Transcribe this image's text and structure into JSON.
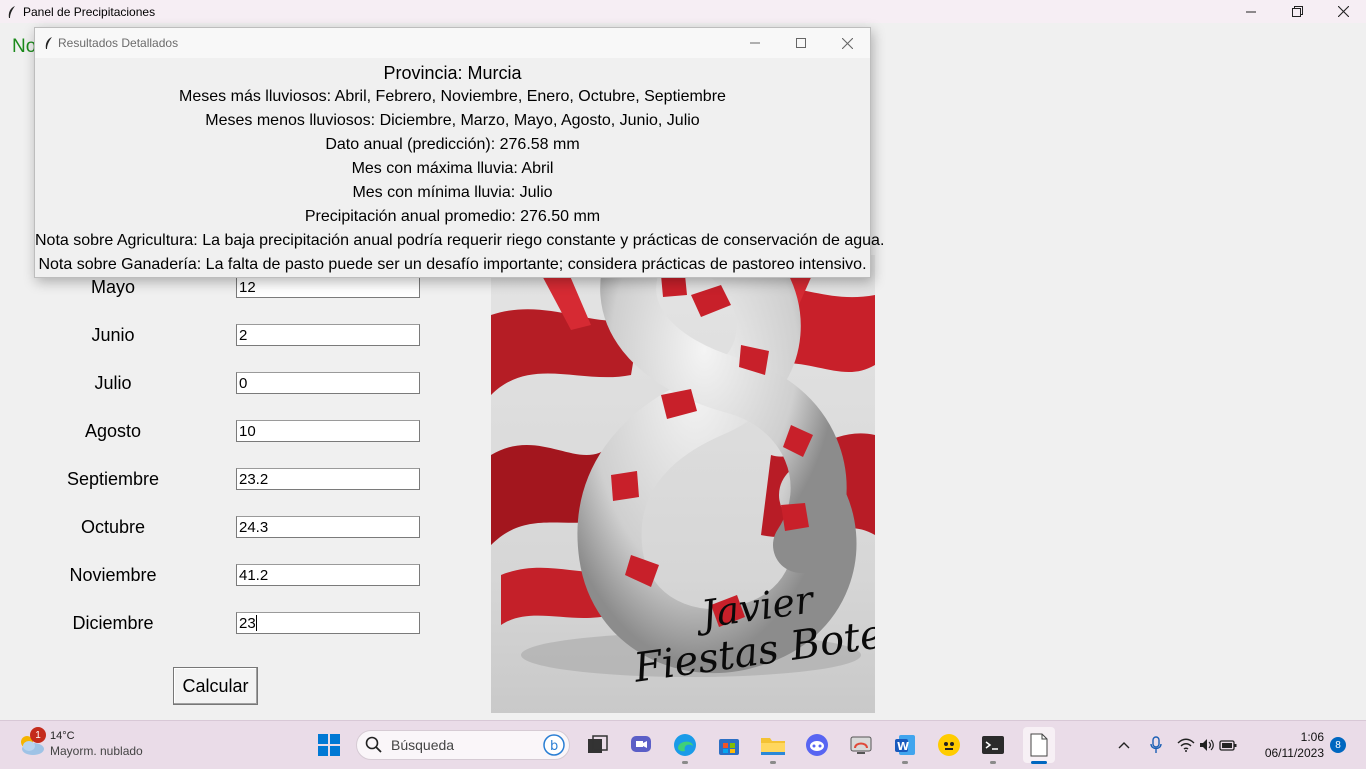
{
  "main_window": {
    "title": "Panel de Precipitaciones",
    "partial_heading": "No"
  },
  "form": {
    "rows": [
      {
        "month": "Mayo",
        "value": "12"
      },
      {
        "month": "Junio",
        "value": "2"
      },
      {
        "month": "Julio",
        "value": "0"
      },
      {
        "month": "Agosto",
        "value": "10"
      },
      {
        "month": "Septiembre",
        "value": "23.2"
      },
      {
        "month": "Octubre",
        "value": "24.3"
      },
      {
        "month": "Noviembre",
        "value": "41.2"
      },
      {
        "month": "Diciembre",
        "value": "23"
      }
    ],
    "calculate_label": "Calcular"
  },
  "artwork": {
    "signature_line1": "Javier",
    "signature_line2": "Fiestas Botella"
  },
  "dialog": {
    "title": "Resultados Detallados",
    "heading": "Provincia: Murcia",
    "lines": [
      "Meses más lluviosos: Abril, Febrero, Noviembre, Enero, Octubre, Septiembre",
      "Meses menos lluviosos: Diciembre, Marzo, Mayo, Agosto, Junio, Julio",
      "Dato anual (predicción): 276.58 mm",
      "Mes con máxima lluvia: Abril",
      "Mes con mínima lluvia: Julio",
      "Precipitación anual promedio: 276.50 mm",
      "Nota sobre Agricultura: La baja precipitación anual podría requerir riego constante y prácticas de conservación de agua.",
      "Nota sobre Ganadería: La falta de pasto puede ser un desafío importante; considera prácticas de pastoreo intensivo."
    ]
  },
  "taskbar": {
    "weather_badge": "1",
    "weather_temp": "14°C",
    "weather_desc": "Mayorm. nublado",
    "search_placeholder": "Búsqueda",
    "time": "1:06",
    "date": "06/11/2023",
    "notification_count": "8"
  },
  "colors": {
    "heading_green": "#1c8a1c",
    "snake_red": "#c8202a",
    "taskbar_bg": "#eadce8"
  }
}
